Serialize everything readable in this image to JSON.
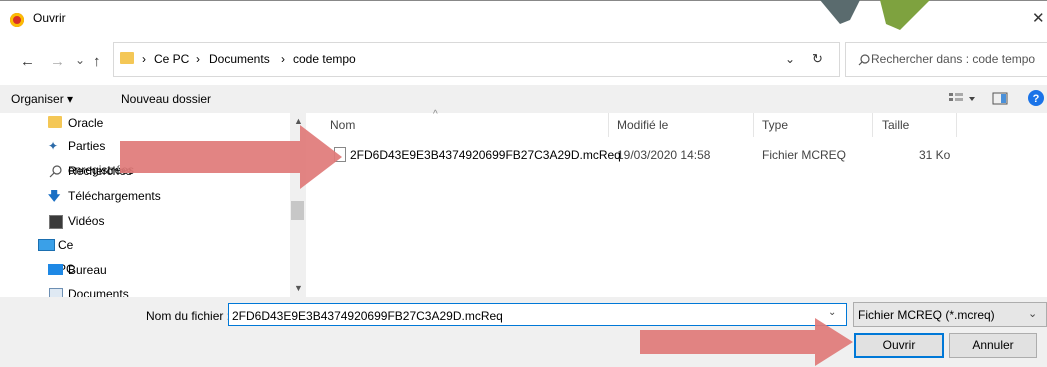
{
  "window": {
    "title": "Ouvrir",
    "close": "✕"
  },
  "nav": {
    "back": "←",
    "forward": "→",
    "recent": "⌄",
    "up": "↑"
  },
  "breadcrumb": {
    "items": [
      "Ce PC",
      "Documents",
      "code tempo"
    ],
    "separator": "›"
  },
  "address": {
    "dropdown": "⌄",
    "refresh": "↻"
  },
  "search": {
    "placeholder": "Rechercher dans : code tempo"
  },
  "toolbar": {
    "organize": "Organiser ▾",
    "new_folder": "Nouveau dossier"
  },
  "tree": [
    "Oracle",
    "Parties enregistrées",
    "Recherches",
    "Téléchargements",
    "Vidéos",
    "Ce PC",
    "Bureau",
    "Documents"
  ],
  "columns": {
    "name": "Nom",
    "modified": "Modifié le",
    "type": "Type",
    "size": "Taille"
  },
  "files": [
    {
      "name": "2FD6D43E9E3B4374920699FB27C3A29D.mcReq",
      "modified": "19/03/2020 14:58",
      "type": "Fichier MCREQ",
      "size": "31 Ko"
    }
  ],
  "footer": {
    "filename_label": "Nom du fichier :",
    "filename_value": "2FD6D43E9E3B4374920699FB27C3A29D.mcReq",
    "filetype": "Fichier MCREQ (*.mcreq)",
    "open": "Ouvrir",
    "cancel": "Annuler"
  },
  "colors": {
    "accent": "#0078d7",
    "arrow": "#df7a78",
    "folder": "#f4c756"
  }
}
